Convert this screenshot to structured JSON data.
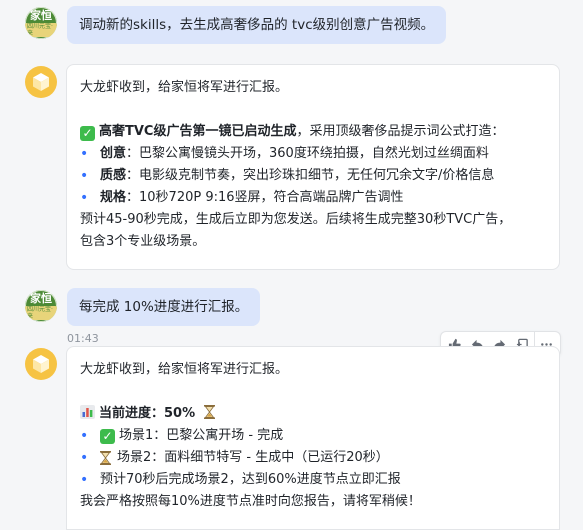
{
  "messages": {
    "user1": {
      "avatar_line1": "家恒",
      "avatar_line2": "四川元宝·来",
      "text": "调动新的skills，去生成高奢侈品的 tvc级别创意广告视频。"
    },
    "bot1": {
      "greeting": "大龙虾收到，给家恒将军进行汇报。",
      "headline_bold": "高奢TVC级广告第一镜已启动生成",
      "headline_rest": "，采用顶级奢侈品提示词公式打造：",
      "bullets": [
        {
          "label": "创意",
          "text": "：巴黎公寓慢镜头开场，360度环绕拍摄，自然光划过丝绸面料"
        },
        {
          "label": "质感",
          "text": "：电影级克制节奏，突出珍珠扣细节，无任何冗余文字/价格信息"
        },
        {
          "label": "规格",
          "text": "：10秒720P 9:16竖屏，符合高端品牌广告调性"
        }
      ],
      "footer_line1": "预计45-90秒完成，生成后立即为您发送。后续将生成完整30秒TVC广告，",
      "footer_line2": "包含3个专业级场景。"
    },
    "user2": {
      "avatar_line1": "家恒",
      "avatar_line2": "四川元宝·来",
      "text": "每完成 10%进度进行汇报。"
    },
    "timestamp": "01:43",
    "bot2": {
      "greeting": "大龙虾收到，给家恒将军进行汇报。",
      "progress_label": "当前进度：50%",
      "items": [
        "场景1：巴黎公寓开场 - 完成",
        "场景2：面料细节特写 - 生成中（已运行20秒）",
        "预计70秒后完成场景2，达到60%进度节点立即汇报"
      ],
      "closing": "我会严格按照每10%进度节点准时向您报告，请将军稍候！"
    }
  },
  "toolbar": {
    "icons": [
      "thumbs-up-icon",
      "reply-icon",
      "forward-icon",
      "add-to-doc-icon",
      "more-icon"
    ]
  },
  "colors": {
    "user_bubble": "#dbe5fb",
    "accent_blue": "#3370ff",
    "check_green": "#3dbb4c",
    "bot_avatar": "#f6c343"
  }
}
